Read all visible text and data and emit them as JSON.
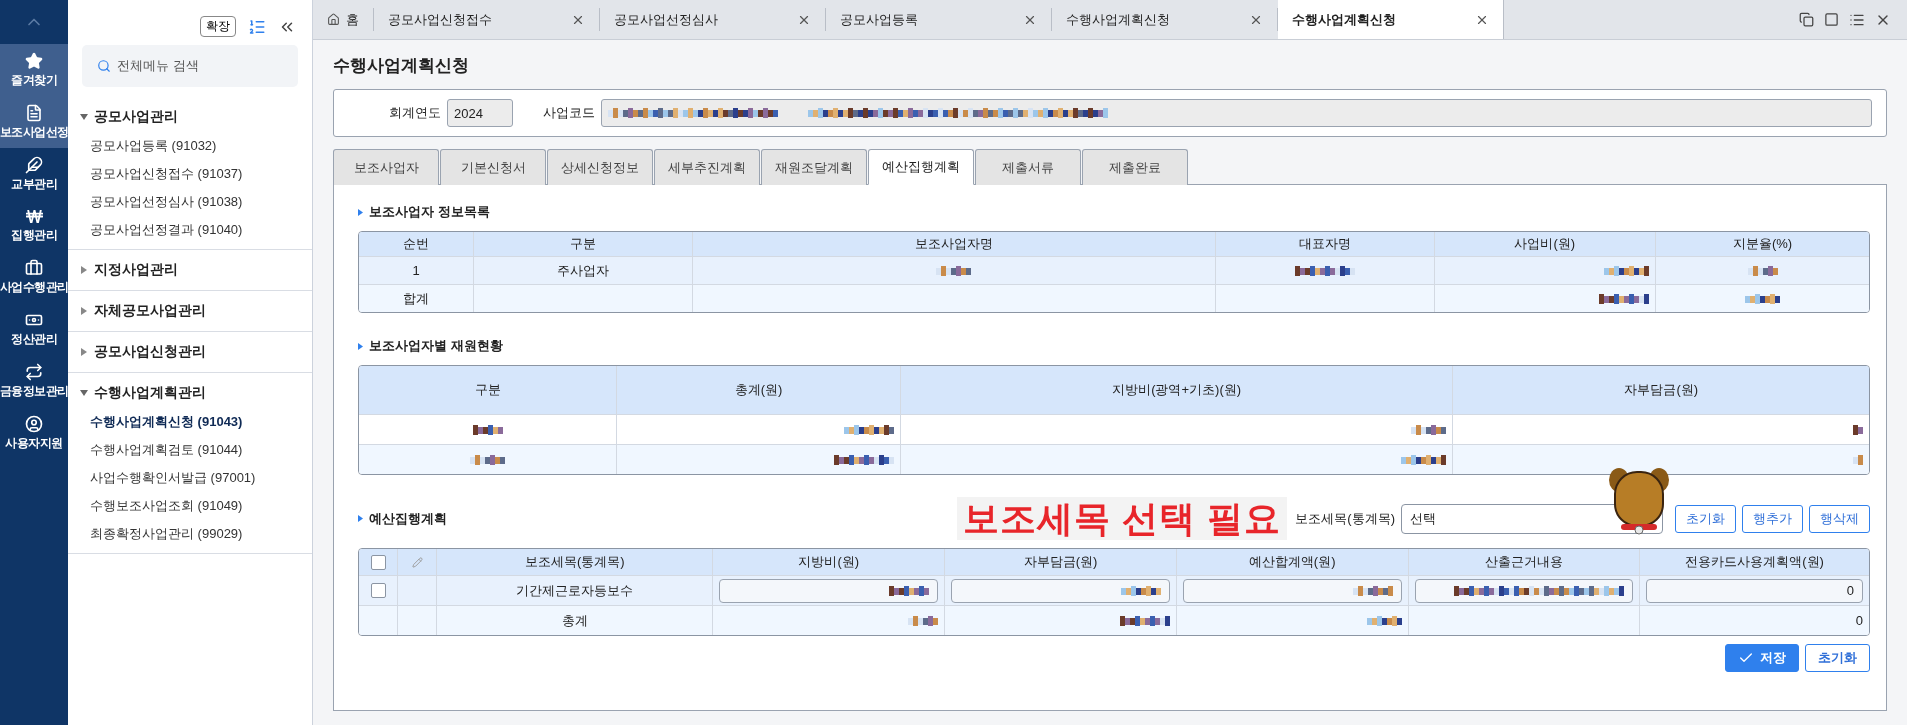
{
  "rail": {
    "items": [
      {
        "label": "즐겨찾기",
        "selected": true
      },
      {
        "label": "보조사업선정",
        "selected": true
      },
      {
        "label": "교부관리",
        "selected": false
      },
      {
        "label": "집행관리",
        "selected": false
      },
      {
        "label": "사업수행관리",
        "selected": false
      },
      {
        "label": "정산관리",
        "selected": false
      },
      {
        "label": "금융정보관리",
        "selected": false
      },
      {
        "label": "사용자지원",
        "selected": false
      }
    ]
  },
  "menu": {
    "expand_button": "확장",
    "search": {
      "placeholder": "전체메뉴 검색"
    },
    "groups": [
      {
        "label": "공모사업관리",
        "expanded": true,
        "children": [
          {
            "label": "공모사업등록 (91032)",
            "selected": false
          },
          {
            "label": "공모사업신청접수 (91037)",
            "selected": false
          },
          {
            "label": "공모사업선정심사 (91038)",
            "selected": false
          },
          {
            "label": "공모사업선정결과 (91040)",
            "selected": false
          }
        ]
      },
      {
        "label": "지정사업관리",
        "expanded": false
      },
      {
        "label": "자체공모사업관리",
        "expanded": false
      },
      {
        "label": "공모사업신청관리",
        "expanded": false
      },
      {
        "label": "수행사업계획관리",
        "expanded": true,
        "children": [
          {
            "label": "수행사업계획신청 (91043)",
            "selected": true
          },
          {
            "label": "수행사업계획검토 (91044)",
            "selected": false
          },
          {
            "label": "사업수행확인서발급 (97001)",
            "selected": false
          },
          {
            "label": "수행보조사업조회 (91049)",
            "selected": false
          },
          {
            "label": "최종확정사업관리 (99029)",
            "selected": false
          }
        ]
      }
    ]
  },
  "tabs": [
    {
      "label": "홈",
      "kind": "home",
      "selected": false
    },
    {
      "label": "공모사업신청접수",
      "kind": "closable",
      "selected": false
    },
    {
      "label": "공모사업선정심사",
      "kind": "closable",
      "selected": false
    },
    {
      "label": "공모사업등록",
      "kind": "closable",
      "selected": false
    },
    {
      "label": "수행사업계획신청",
      "kind": "closable",
      "selected": false
    },
    {
      "label": "수행사업계획신청",
      "kind": "closable",
      "selected": true
    }
  ],
  "page": {
    "title": "수행사업계획신청",
    "fiscal_year": {
      "label": "회계연도",
      "value": "2024"
    },
    "project_code": {
      "label": "사업코드"
    },
    "subtabs": [
      {
        "label": "보조사업자",
        "selected": false
      },
      {
        "label": "기본신청서",
        "selected": false
      },
      {
        "label": "상세신청정보",
        "selected": false
      },
      {
        "label": "세부추진계획",
        "selected": false
      },
      {
        "label": "재원조달계획",
        "selected": false
      },
      {
        "label": "예산집행계획",
        "selected": true
      },
      {
        "label": "제출서류",
        "selected": false
      },
      {
        "label": "제출완료",
        "selected": false
      }
    ],
    "sections": [
      {
        "title": "보조사업자 정보목록",
        "table": {
          "columns": [
            {
              "label": "순번"
            },
            {
              "label": "구분"
            },
            {
              "label": "보조사업자명"
            },
            {
              "label": "대표자명"
            },
            {
              "label": "사업비(원)"
            },
            {
              "label": "지분율(%)"
            }
          ],
          "rows": [
            {
              "cells": [
                {
                  "kind": "text",
                  "text": "1"
                },
                {
                  "kind": "text",
                  "text": "주사업자"
                },
                {
                  "kind": "redacted"
                },
                {
                  "kind": "redacted"
                },
                {
                  "kind": "redacted"
                },
                {
                  "kind": "redacted"
                }
              ]
            },
            {
              "cells": [
                {
                  "kind": "text",
                  "text": "합계"
                },
                {
                  "kind": "empty"
                },
                {
                  "kind": "empty"
                },
                {
                  "kind": "empty"
                },
                {
                  "kind": "redacted"
                },
                {
                  "kind": "redacted"
                }
              ]
            }
          ]
        }
      },
      {
        "title": "보조사업자별 재원현황",
        "table": {
          "columns": [
            {
              "label": "구분"
            },
            {
              "label": "총계(원)"
            },
            {
              "label": "지방비(광역+기초)(원)"
            },
            {
              "label": "자부담금(원)"
            }
          ],
          "rows": [
            {
              "cells": [
                {
                  "kind": "redacted"
                },
                {
                  "kind": "redacted"
                },
                {
                  "kind": "redacted"
                },
                {
                  "kind": "redacted"
                }
              ]
            },
            {
              "cells": [
                {
                  "kind": "redacted"
                },
                {
                  "kind": "redacted"
                },
                {
                  "kind": "redacted"
                },
                {
                  "kind": "redacted"
                }
              ]
            }
          ]
        }
      },
      {
        "title": "예산집행계획",
        "notice": "보조세목 선택 필요",
        "filter": {
          "label": "보조세목(통계목)",
          "value": "선택"
        },
        "buttons": [
          "초기화",
          "행추가",
          "행삭제"
        ],
        "table": {
          "columns": [
            {
              "kind": "checkbox",
              "checked": false
            },
            {
              "kind": "edit"
            },
            {
              "label": "보조세목(통계목)"
            },
            {
              "label": "지방비(원)"
            },
            {
              "label": "자부담금(원)"
            },
            {
              "label": "예산합계액(원)"
            },
            {
              "label": "산출근거내용"
            },
            {
              "label": "전용카드사용계획액(원)"
            }
          ],
          "rows": [
            {
              "cells": [
                {
                  "kind": "checkbox",
                  "checked": false
                },
                {
                  "kind": "empty"
                },
                {
                  "kind": "text",
                  "text": "기간제근로자등보수"
                },
                {
                  "kind": "input"
                },
                {
                  "kind": "input"
                },
                {
                  "kind": "input"
                },
                {
                  "kind": "input"
                },
                {
                  "kind": "input",
                  "text": "0"
                }
              ]
            },
            {
              "cells": [
                {
                  "kind": "empty"
                },
                {
                  "kind": "empty"
                },
                {
                  "kind": "text",
                  "text": "총계"
                },
                {
                  "kind": "redacted"
                },
                {
                  "kind": "redacted"
                },
                {
                  "kind": "redacted"
                },
                {
                  "kind": "empty"
                },
                {
                  "kind": "text",
                  "text": "0"
                }
              ]
            }
          ]
        },
        "footer_buttons": [
          {
            "label": "저장",
            "kind": "primary"
          },
          {
            "label": "초기화",
            "kind": "secondary"
          }
        ]
      }
    ]
  }
}
